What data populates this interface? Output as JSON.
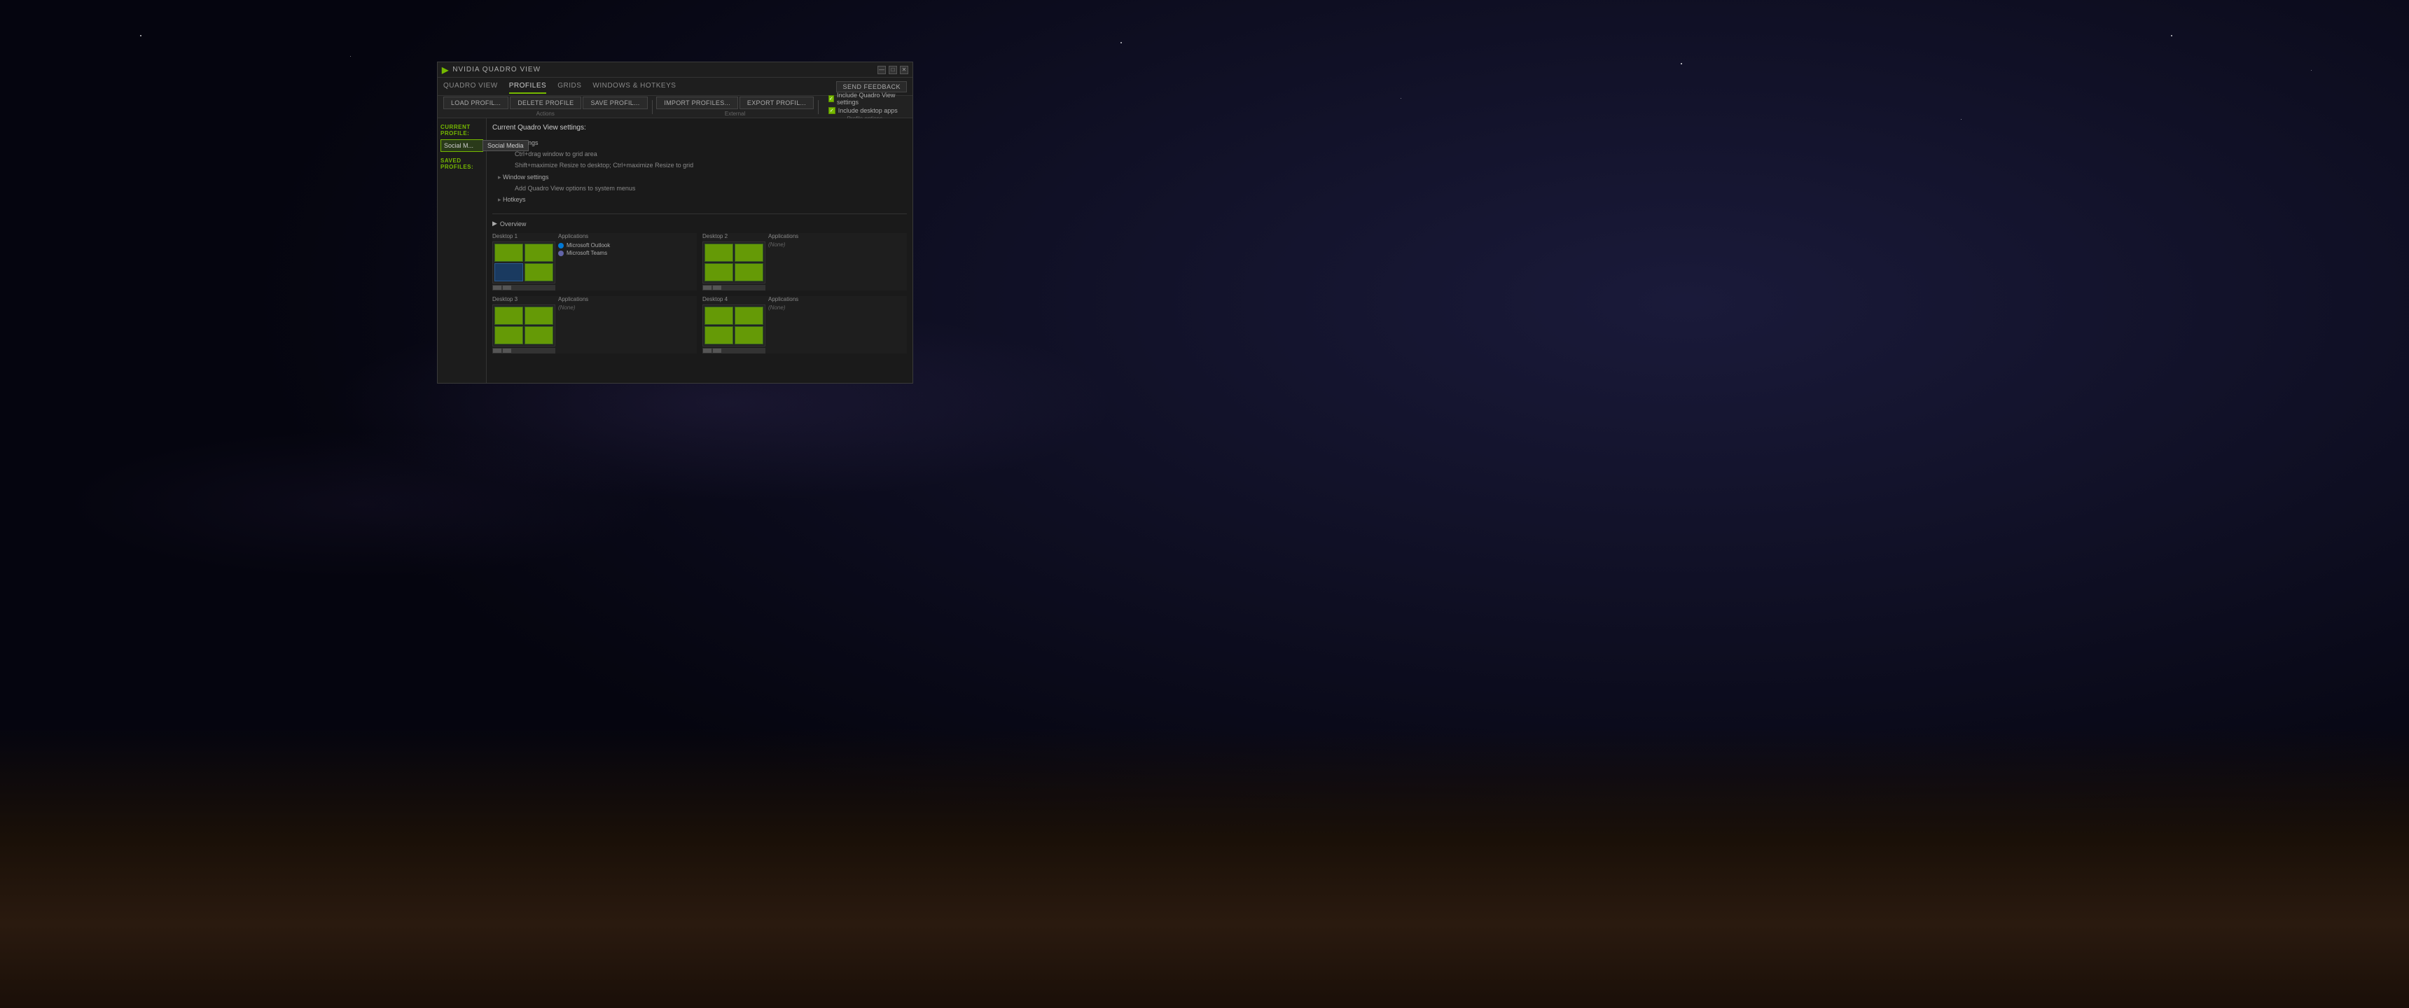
{
  "background": {
    "description": "Dark starfield with milky way and rocky terrain"
  },
  "window": {
    "title": "NVIDIA QUADRO VIEW",
    "logo_char": "▶"
  },
  "title_controls": {
    "minimize": "—",
    "maximize": "□",
    "close": "✕"
  },
  "nav": {
    "tabs": [
      {
        "id": "quadro-view",
        "label": "QUADRO VIEW",
        "active": false
      },
      {
        "id": "profiles",
        "label": "PROFILES",
        "active": true
      },
      {
        "id": "grids",
        "label": "GRIDS",
        "active": false
      },
      {
        "id": "windows-hotkeys",
        "label": "WINDOWS & HOTKEYS",
        "active": false
      }
    ],
    "send_feedback": "SEND FEEDBACK"
  },
  "toolbar": {
    "actions_label": "Actions",
    "external_label": "External",
    "profile_options_label": "Profile options",
    "buttons": [
      {
        "id": "load-profile",
        "label": "LOAD PROFIL..."
      },
      {
        "id": "delete-profile",
        "label": "DELETE PROFILE"
      },
      {
        "id": "save-profile",
        "label": "SAVE PROFIL..."
      },
      {
        "id": "import-profiles",
        "label": "IMPORT PROFILES..."
      },
      {
        "id": "export-profiles",
        "label": "EXPORT PROFIL..."
      }
    ],
    "profile_options": [
      {
        "id": "include-quadro-view",
        "label": "Include Quadro View settings",
        "checked": true
      },
      {
        "id": "include-desktop-apps",
        "label": "Include desktop apps",
        "checked": true
      }
    ]
  },
  "sidebar": {
    "current_profile_label": "CURRENT PROFILE:",
    "current_profile_name": "Social M...",
    "tooltip_text": "Social Media",
    "saved_profiles_label": "SAVED PROFILES:"
  },
  "content": {
    "settings_title": "Current Quadro View settings:",
    "settings_groups": [
      {
        "label": "Grid settings",
        "items": [
          "Ctrl+drag window to grid area",
          "Shift+maximize Resize to desktop; Ctrl+maximize Resize to grid"
        ]
      },
      {
        "label": "Window settings",
        "items": [
          "Add Quadro View options to system menus"
        ]
      },
      {
        "label": "Hotkeys",
        "items": []
      }
    ]
  },
  "overview": {
    "label": "Overview",
    "desktops": [
      {
        "id": "desktop-1",
        "label": "Desktop 1",
        "apps_label": "Applications",
        "apps": [
          {
            "name": "Microsoft Outlook",
            "dot_class": "outlook"
          },
          {
            "name": "Microsoft Teams",
            "dot_class": "teams"
          }
        ]
      },
      {
        "id": "desktop-2",
        "label": "Desktop 2",
        "apps_label": "Applications",
        "apps": [],
        "apps_none": "(None)"
      },
      {
        "id": "desktop-3",
        "label": "Desktop 3",
        "apps_label": "Applications",
        "apps": [],
        "apps_none": "(None)"
      },
      {
        "id": "desktop-4",
        "label": "Desktop 4",
        "apps_label": "Applications",
        "apps": [],
        "apps_none": "(None)"
      }
    ]
  }
}
